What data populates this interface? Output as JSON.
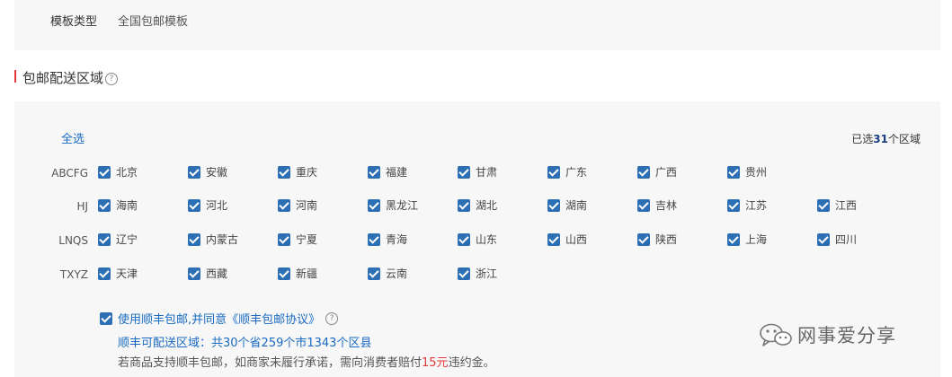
{
  "template": {
    "type_label": "模板类型",
    "type_value": "全国包邮模板"
  },
  "section": {
    "title": "包邮配送区域",
    "help_icon": "question-circle-icon"
  },
  "regions": {
    "select_all": "全选",
    "selected_prefix": "已选",
    "selected_count": "31",
    "selected_suffix": "个区域",
    "groups": [
      {
        "label": "ABCFG",
        "items": [
          "北京",
          "安徽",
          "重庆",
          "福建",
          "甘肃",
          "广东",
          "广西",
          "贵州"
        ]
      },
      {
        "label": "HJ",
        "items": [
          "海南",
          "河北",
          "河南",
          "黑龙江",
          "湖北",
          "湖南",
          "吉林",
          "江苏",
          "江西"
        ]
      },
      {
        "label": "LNQS",
        "items": [
          "辽宁",
          "内蒙古",
          "宁夏",
          "青海",
          "山东",
          "山西",
          "陕西",
          "上海",
          "四川"
        ]
      },
      {
        "label": "TXYZ",
        "items": [
          "天津",
          "西藏",
          "新疆",
          "云南",
          "浙江"
        ]
      }
    ]
  },
  "shunfeng": {
    "agree_text": "使用顺丰包邮,并同意《顺丰包邮协议》",
    "coverage_text": "顺丰可配送区域：共30个省259个市1343个区县",
    "penalty_prefix": "若商品支持顺丰包邮，如商家未履行承诺，需向消费者赔付",
    "penalty_amount": "15元",
    "penalty_suffix": "违约金。"
  },
  "watermark": {
    "text": "网事爱分享",
    "icon": "wechat-logo-icon"
  }
}
